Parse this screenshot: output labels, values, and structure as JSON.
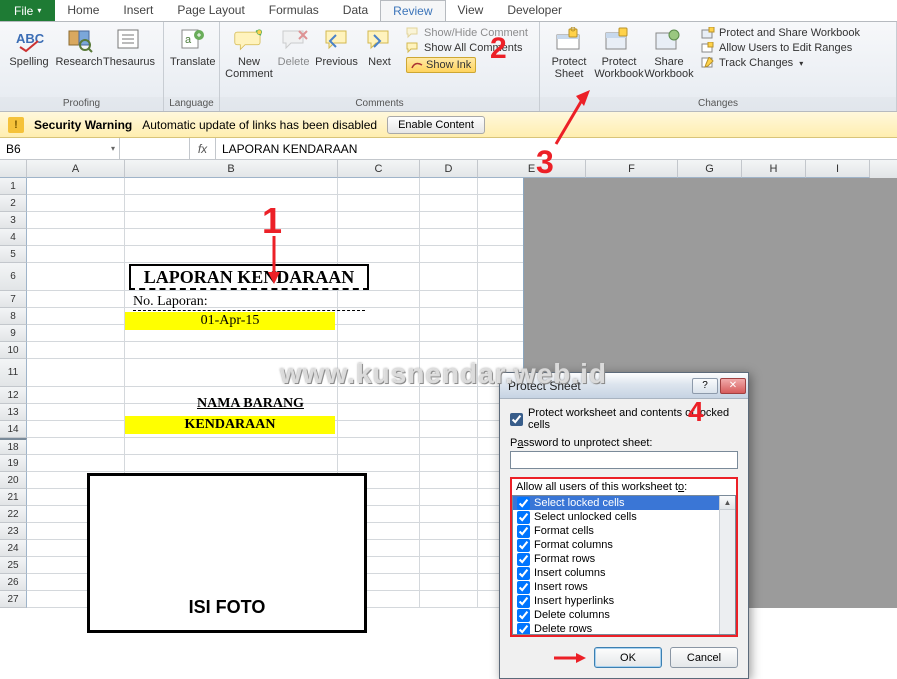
{
  "tabs": {
    "file": "File",
    "home": "Home",
    "insert": "Insert",
    "page_layout": "Page Layout",
    "formulas": "Formulas",
    "data": "Data",
    "review": "Review",
    "view": "View",
    "developer": "Developer"
  },
  "ribbon": {
    "proofing": {
      "label": "Proofing",
      "spelling": "Spelling",
      "research": "Research",
      "thesaurus": "Thesaurus"
    },
    "language": {
      "label": "Language",
      "translate": "Translate"
    },
    "comments": {
      "label": "Comments",
      "new": "New Comment",
      "delete": "Delete",
      "previous": "Previous",
      "next": "Next",
      "show_hide": "Show/Hide Comment",
      "show_all": "Show All Comments",
      "show_ink": "Show Ink"
    },
    "changes": {
      "label": "Changes",
      "protect_sheet": "Protect Sheet",
      "protect_wb": "Protect Workbook",
      "share_wb": "Share Workbook",
      "protect_share": "Protect and Share Workbook",
      "allow_ranges": "Allow Users to Edit Ranges",
      "track": "Track Changes"
    }
  },
  "security": {
    "warning": "Security Warning",
    "msg": "Automatic update of links has been disabled",
    "enable": "Enable Content"
  },
  "namebox": "B6",
  "formula": "LAPORAN KENDARAAN",
  "columns": [
    "A",
    "B",
    "C",
    "D",
    "E",
    "F",
    "G",
    "H",
    "I"
  ],
  "rows": [
    "1",
    "2",
    "3",
    "4",
    "5",
    "6",
    "7",
    "8",
    "9",
    "10",
    "11",
    "12",
    "13",
    "14",
    "18",
    "19",
    "20",
    "21",
    "22",
    "23",
    "24",
    "25",
    "26",
    "27"
  ],
  "sheet": {
    "title": "LAPORAN KENDARAAN",
    "no_lap": "No. Laporan:",
    "date": "01-Apr-15",
    "nama_barang": "NAMA BARANG",
    "kendaraan": "KENDARAAN",
    "isi_foto": "ISI FOTO"
  },
  "dialog": {
    "title": "Protect Sheet",
    "protect_chk": "Protect worksheet and contents of locked cells",
    "pw_label_pre": "P",
    "pw_label_u": "a",
    "pw_label_post": "ssword to unprotect sheet:",
    "allow_label_pre": "Allow all users of this worksheet t",
    "allow_label_u": "o",
    "allow_label_post": ":",
    "items": [
      "Select locked cells",
      "Select unlocked cells",
      "Format cells",
      "Format columns",
      "Format rows",
      "Insert columns",
      "Insert rows",
      "Insert hyperlinks",
      "Delete columns",
      "Delete rows"
    ],
    "ok": "OK",
    "cancel": "Cancel"
  },
  "watermark": "www.kusnendar.web.id",
  "ann": {
    "1": "1",
    "2": "2",
    "3": "3",
    "4": "4"
  }
}
